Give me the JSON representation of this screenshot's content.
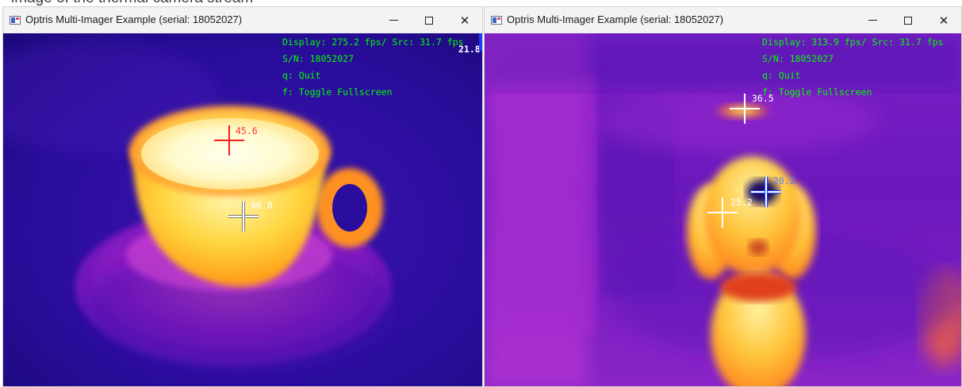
{
  "caption_fragment": "image of the thermal camera stream",
  "windows": [
    {
      "title": "Optris Multi-Imager Example (serial: 18052027)",
      "controls": {
        "minimize": "—",
        "maximize": "☐",
        "close": "✕"
      },
      "osd": {
        "display": "Display: 275.2 fps/ Src: 31.7 fps",
        "serial": "S/N: 18052027",
        "quit": "q: Quit",
        "fullscreen": "f: Toggle Fullscreen",
        "corner_temp": "21.8"
      },
      "markers": [
        {
          "label": "45.6",
          "type": "max",
          "color": "#ff1a1a"
        },
        {
          "label": "40.8",
          "type": "center",
          "color": "#ffffff"
        }
      ]
    },
    {
      "title": "Optris Multi-Imager Example (serial: 18052027)",
      "controls": {
        "minimize": "—",
        "maximize": "☐",
        "close": "✕"
      },
      "osd": {
        "display": "Display: 313.9 fps/ Src: 31.7 fps",
        "serial": "S/N: 18052027",
        "quit": "q: Quit",
        "fullscreen": "f: Toggle Fullscreen"
      },
      "markers": [
        {
          "label": "36.5",
          "type": "max",
          "color": "#ffffff"
        },
        {
          "label": "20.2",
          "type": "min",
          "color": "#1a3cff"
        },
        {
          "label": "25.2",
          "type": "center",
          "color": "#ffffff"
        }
      ]
    }
  ],
  "colors": {
    "palette_cold": "#1c0a8a",
    "palette_mid": "#b520d0",
    "palette_warm": "#ff7a1a",
    "palette_hot": "#ffffe6",
    "osd_text": "#00ff00"
  }
}
